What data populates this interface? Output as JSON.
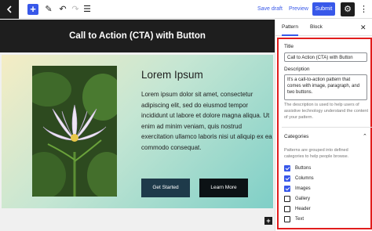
{
  "toolbar": {
    "wp_icon": "wordpress-icon",
    "add_glyph": "+",
    "edit_glyph": "✎",
    "undo_glyph": "↶",
    "redo_glyph": "↷",
    "list_glyph": "☰",
    "save_draft": "Save draft",
    "preview": "Preview",
    "submit": "Submit",
    "settings_glyph": "⚙",
    "more_glyph": "⋮"
  },
  "canvas": {
    "title": "Call to Action (CTA) with Button",
    "cta": {
      "heading": "Lorem Ipsum",
      "body": "Lorem ipsum dolor sit amet, consectetur adipiscing elit, sed do eiusmod tempor incididunt ut labore et dolore magna aliqua. Ut enim ad minim veniam, quis nostrud exercitation ullamco laboris nisi ut aliquip ex ea commodo consequat.",
      "primary_button": "Get Started",
      "secondary_button": "Learn More"
    },
    "add_block_glyph": "+"
  },
  "sidebar": {
    "tabs": [
      "Pattern",
      "Block"
    ],
    "close_glyph": "✕",
    "title_label": "Title",
    "title_value": "Call to Action (CTA) with Button",
    "description_label": "Description",
    "description_value": "It's a call-to-action pattern that comes with image, paragraph, and two buttons.",
    "description_help": "The description is used to help users of assistive technology understand the content of your pattern.",
    "categories_label": "Categories",
    "categories_chevron": "⌃",
    "categories_help": "Patterns are grouped into defined categories to help people browse.",
    "categories": [
      {
        "label": "Buttons",
        "checked": true
      },
      {
        "label": "Columns",
        "checked": true
      },
      {
        "label": "Images",
        "checked": true
      },
      {
        "label": "Gallery",
        "checked": false
      },
      {
        "label": "Header",
        "checked": false
      },
      {
        "label": "Text",
        "checked": false
      }
    ]
  },
  "colors": {
    "accent": "#3858e9",
    "highlight_frame": "#e11d1d",
    "title_bar": "#1e1e1e"
  }
}
